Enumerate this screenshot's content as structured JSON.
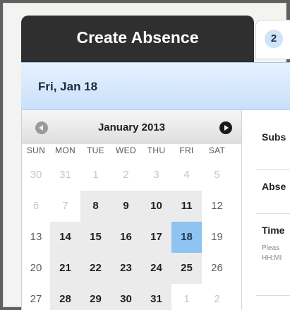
{
  "tabs": {
    "active_title": "Create Absence",
    "second_number": "2"
  },
  "date_header": "Fri, Jan 18",
  "calendar": {
    "month_label": "January 2013",
    "weekdays": [
      "SUN",
      "MON",
      "TUE",
      "WED",
      "THU",
      "FRI",
      "SAT"
    ],
    "weeks": [
      [
        "30",
        "31",
        "1",
        "2",
        "3",
        "4",
        "5"
      ],
      [
        "6",
        "7",
        "8",
        "9",
        "10",
        "11",
        "12"
      ],
      [
        "13",
        "14",
        "15",
        "16",
        "17",
        "18",
        "19"
      ],
      [
        "20",
        "21",
        "22",
        "23",
        "24",
        "25",
        "26"
      ],
      [
        "27",
        "28",
        "29",
        "30",
        "31",
        "1",
        "2"
      ]
    ],
    "selected_day": "18"
  },
  "side_panel": {
    "field_1": "Subs",
    "field_2": "Abse",
    "field_3": "Time",
    "hint_line_1": "Pleas",
    "hint_line_2": "HH:MI"
  },
  "colors": {
    "tab_dark": "#2f2f2f",
    "header_blue": "#c9e0fb",
    "selected_day": "#8fc3f1"
  }
}
